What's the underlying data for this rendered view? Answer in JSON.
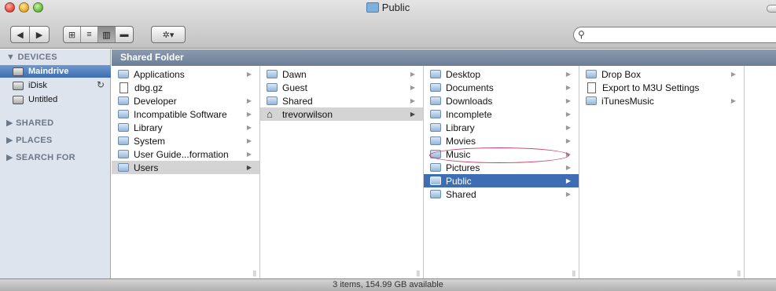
{
  "window": {
    "title": "Public"
  },
  "toolbar": {
    "back_glyph": "◀",
    "forward_glyph": "▶",
    "view_icons": [
      "⊞",
      "≡",
      "▥",
      "▬"
    ],
    "action_glyph": "✲▾",
    "search_placeholder": ""
  },
  "sidebar": {
    "devices_header": "▼ DEVICES",
    "devices": [
      {
        "label": "Maindrive",
        "icon": "hard-drive-icon"
      },
      {
        "label": "iDisk",
        "icon": "idisk-icon"
      },
      {
        "label": "Untitled",
        "icon": "disk-icon"
      }
    ],
    "idisk_sync_glyph": "↻",
    "shared_header": "▶ SHARED",
    "places_header": "▶ PLACES",
    "search_header": "▶ SEARCH FOR"
  },
  "column_header": "Shared Folder",
  "columns": [
    {
      "items": [
        {
          "label": "Applications",
          "icon": "folder",
          "arrow": true
        },
        {
          "label": "dbg.gz",
          "icon": "file",
          "arrow": false
        },
        {
          "label": "Developer",
          "icon": "folder",
          "arrow": true
        },
        {
          "label": "Incompatible Software",
          "icon": "folder",
          "arrow": true
        },
        {
          "label": "Library",
          "icon": "folder",
          "arrow": true
        },
        {
          "label": "System",
          "icon": "folder",
          "arrow": true
        },
        {
          "label": "User Guide...formation",
          "icon": "folder",
          "arrow": true
        },
        {
          "label": "Users",
          "icon": "folder",
          "arrow": true,
          "selected": "gray"
        }
      ]
    },
    {
      "items": [
        {
          "label": "Dawn",
          "icon": "folder",
          "arrow": true
        },
        {
          "label": "Guest",
          "icon": "folder",
          "arrow": true
        },
        {
          "label": "Shared",
          "icon": "folder",
          "arrow": true
        },
        {
          "label": "trevorwilson",
          "icon": "home",
          "arrow": true,
          "selected": "gray"
        }
      ]
    },
    {
      "items": [
        {
          "label": "Desktop",
          "icon": "folder",
          "arrow": true
        },
        {
          "label": "Documents",
          "icon": "folder",
          "arrow": true
        },
        {
          "label": "Downloads",
          "icon": "folder",
          "arrow": true
        },
        {
          "label": "Incomplete",
          "icon": "folder",
          "arrow": true
        },
        {
          "label": "Library",
          "icon": "folder",
          "arrow": true
        },
        {
          "label": "Movies",
          "icon": "folder",
          "arrow": true
        },
        {
          "label": "Music",
          "icon": "folder",
          "arrow": true
        },
        {
          "label": "Pictures",
          "icon": "folder",
          "arrow": true
        },
        {
          "label": "Public",
          "icon": "folder",
          "arrow": true,
          "selected": "blue"
        },
        {
          "label": "Shared",
          "icon": "folder",
          "arrow": true
        }
      ]
    },
    {
      "items": [
        {
          "label": "Drop Box",
          "icon": "folder",
          "arrow": true
        },
        {
          "label": "Export to M3U Settings",
          "icon": "file",
          "arrow": false
        },
        {
          "label": "iTunesMusic",
          "icon": "folder",
          "arrow": true
        }
      ]
    }
  ],
  "status": "3 items, 154.99 GB available",
  "colors": {
    "selection_blue": "#3e6db3",
    "highlight_ellipse": "#c8376e",
    "header_bar": "#7a8ba3"
  }
}
